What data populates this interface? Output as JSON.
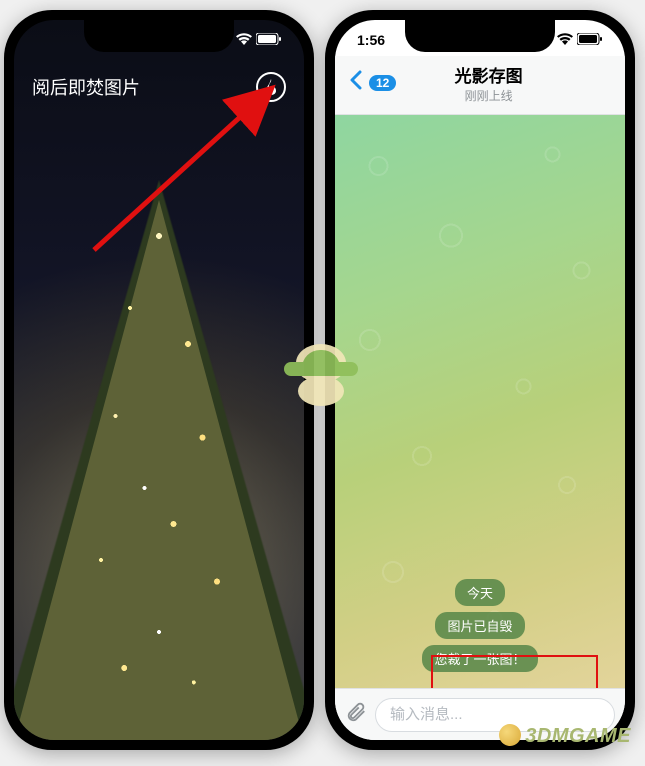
{
  "left": {
    "title": "阅后即焚图片",
    "flame_icon": "flame-icon"
  },
  "right": {
    "time": "1:56",
    "unread_count": "12",
    "title": "光影存图",
    "subtitle": "刚刚上线",
    "date_pill": "今天",
    "msg_destroyed": "图片已自毁",
    "msg_cropped": "您裁了一张图！",
    "input_placeholder": "输入消息..."
  },
  "watermark": "3DMGAME"
}
